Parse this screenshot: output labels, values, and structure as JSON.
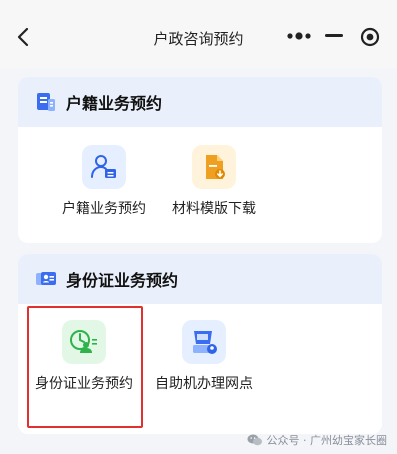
{
  "nav": {
    "title": "户政咨询预约",
    "back_icon": "chevron-left-icon",
    "more_icon": "more-dots-icon",
    "minimize_icon": "minimize-icon",
    "close_icon": "target-close-icon"
  },
  "sections": [
    {
      "title": "户籍业务预约",
      "icon": "household-register-icon",
      "items": [
        {
          "label": "户籍业务预约",
          "icon": "person-card-icon"
        },
        {
          "label": "材料模版下载",
          "icon": "document-download-icon"
        }
      ]
    },
    {
      "title": "身份证业务预约",
      "icon": "id-card-section-icon",
      "items": [
        {
          "label": "身份证业务预约",
          "icon": "id-clock-person-icon"
        },
        {
          "label": "自助机办理网点",
          "icon": "self-service-kiosk-icon"
        }
      ]
    }
  ],
  "watermark": {
    "text": "公众号 · 广州幼宝家长圈",
    "icon": "wechat-icon"
  },
  "colors": {
    "page_bg": "#f3f5f9",
    "section_header_bg": "#eaf0fb",
    "highlight_border": "#e0312f",
    "blue_icon_bg": "#e6efff",
    "orange_icon_bg": "#fff3dc",
    "green_icon_bg": "#e3f7e6"
  }
}
